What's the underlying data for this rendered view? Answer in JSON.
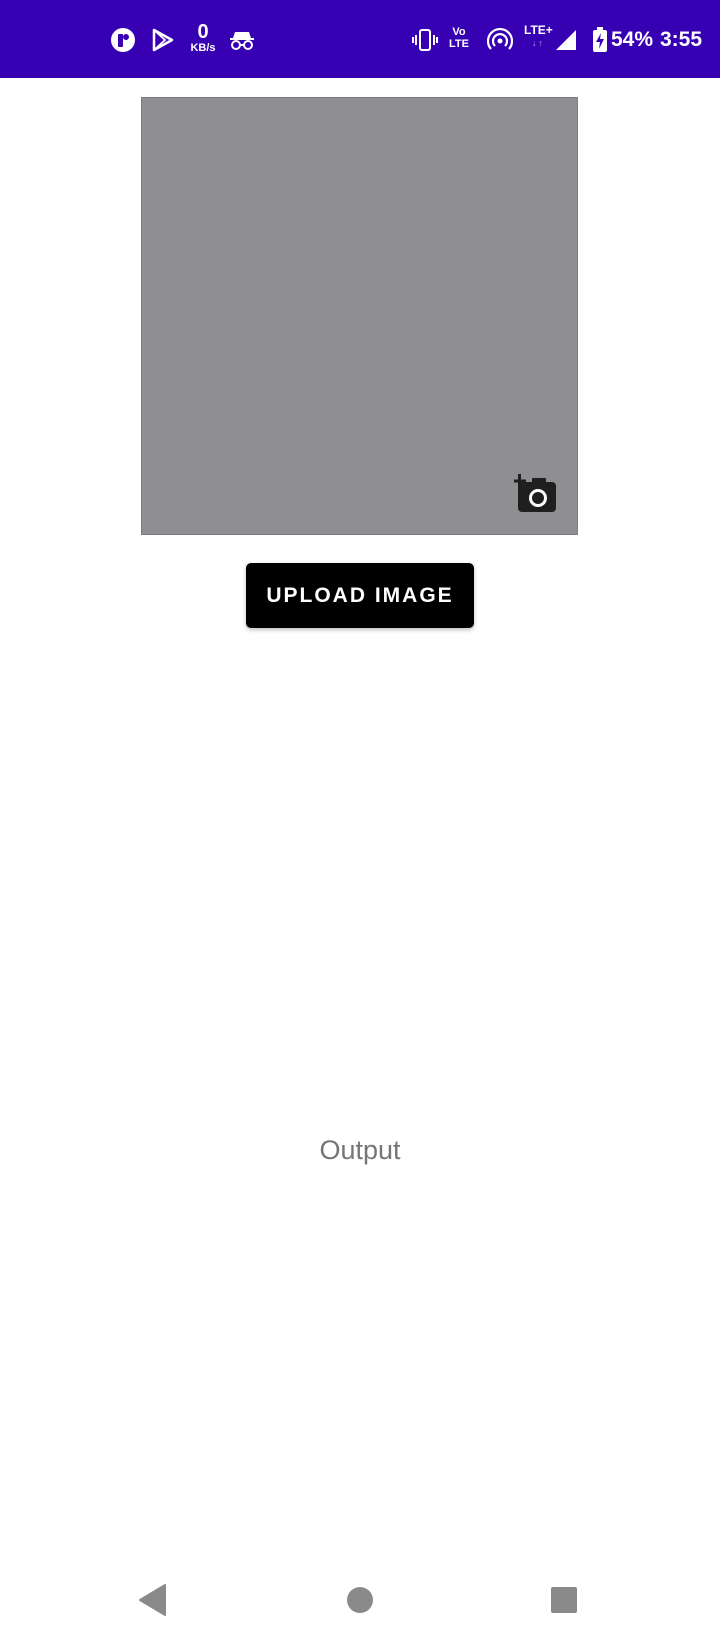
{
  "status_bar": {
    "background_color": "#3700b3",
    "data_speed_value": "0",
    "data_speed_unit": "KB/s",
    "volte_line1": "Vo",
    "volte_line2": "LTE",
    "network_type": "LTE+",
    "network_arrows": "↓↑",
    "battery_percent": "54%",
    "time": "3:55",
    "left_icons": [
      "app-notification-icon",
      "play-store-icon",
      "data-speed-indicator",
      "incognito-icon"
    ],
    "right_icons": [
      "vibrate-icon",
      "volte-indicator",
      "hotspot-icon",
      "lte-plus-indicator",
      "signal-icon",
      "battery-icon"
    ]
  },
  "image_preview": {
    "background_color": "#8f8e93",
    "camera_icon": "add-a-photo-icon"
  },
  "upload_button": {
    "label": "UPLOAD IMAGE",
    "background_color": "#000000"
  },
  "output": {
    "text": "Output",
    "color": "#757575"
  },
  "nav_bar": {
    "icons": [
      "back-icon",
      "home-icon",
      "recents-icon"
    ],
    "icon_color": "#8a8a8a"
  }
}
